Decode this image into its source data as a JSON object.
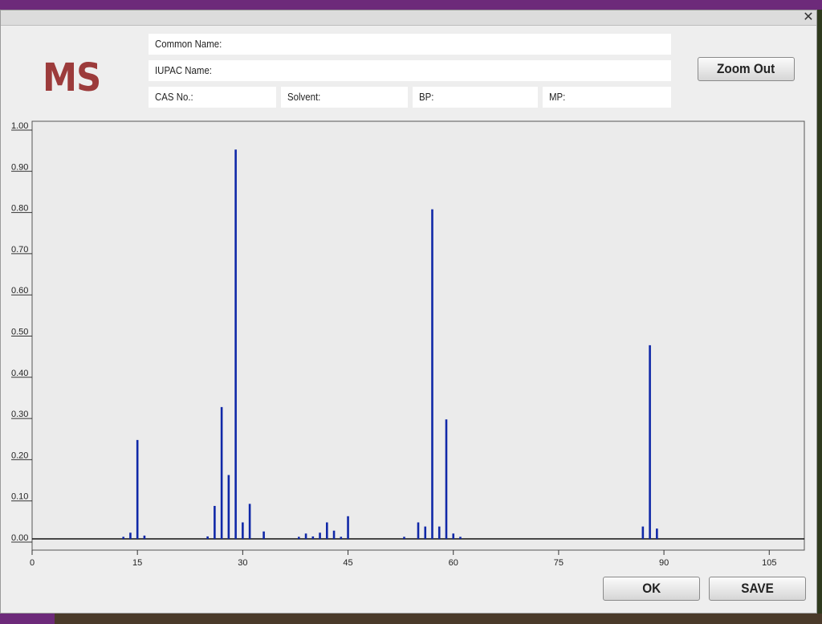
{
  "window": {
    "close_glyph": "✕"
  },
  "logo": "MS",
  "fields": {
    "common_name": "Common Name:",
    "iupac_name": "IUPAC Name:",
    "cas_no": "CAS No.:",
    "solvent": "Solvent:",
    "bp": "BP:",
    "mp": "MP:"
  },
  "buttons": {
    "zoom_out": "Zoom Out",
    "ok": "OK",
    "save": "SAVE"
  },
  "colors": {
    "peak": "#1028a8",
    "logo": "#9c3b3b"
  },
  "chart_data": {
    "type": "bar",
    "title": "",
    "xlabel": "",
    "ylabel": "",
    "xlim": [
      0,
      110
    ],
    "ylim": [
      0,
      1.0
    ],
    "x_ticks": [
      0,
      15,
      30,
      45,
      60,
      75,
      90,
      105
    ],
    "y_ticks": [
      "0.00",
      "0.10",
      "0.20",
      "0.30",
      "0.40",
      "0.50",
      "0.60",
      "0.70",
      "0.80",
      "0.90",
      "1.00"
    ],
    "series": [
      {
        "peaks": [
          {
            "x": 13,
            "y": 0.005
          },
          {
            "x": 14,
            "y": 0.015
          },
          {
            "x": 15,
            "y": 0.24
          },
          {
            "x": 16,
            "y": 0.008
          },
          {
            "x": 25,
            "y": 0.006
          },
          {
            "x": 26,
            "y": 0.08
          },
          {
            "x": 27,
            "y": 0.32
          },
          {
            "x": 28,
            "y": 0.155
          },
          {
            "x": 29,
            "y": 0.945
          },
          {
            "x": 30,
            "y": 0.04
          },
          {
            "x": 31,
            "y": 0.085
          },
          {
            "x": 33,
            "y": 0.018
          },
          {
            "x": 38,
            "y": 0.005
          },
          {
            "x": 39,
            "y": 0.013
          },
          {
            "x": 40,
            "y": 0.006
          },
          {
            "x": 41,
            "y": 0.015
          },
          {
            "x": 42,
            "y": 0.04
          },
          {
            "x": 43,
            "y": 0.02
          },
          {
            "x": 44,
            "y": 0.005
          },
          {
            "x": 45,
            "y": 0.055
          },
          {
            "x": 53,
            "y": 0.005
          },
          {
            "x": 55,
            "y": 0.04
          },
          {
            "x": 56,
            "y": 0.03
          },
          {
            "x": 57,
            "y": 0.8
          },
          {
            "x": 58,
            "y": 0.03
          },
          {
            "x": 59,
            "y": 0.29
          },
          {
            "x": 60,
            "y": 0.013
          },
          {
            "x": 61,
            "y": 0.005
          },
          {
            "x": 87,
            "y": 0.03
          },
          {
            "x": 88,
            "y": 0.47
          },
          {
            "x": 89,
            "y": 0.025
          }
        ]
      }
    ]
  }
}
